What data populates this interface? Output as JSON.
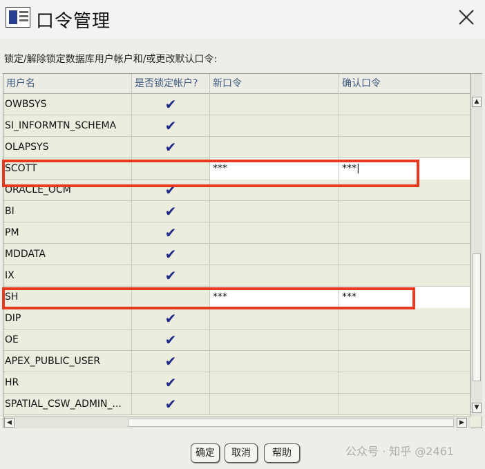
{
  "window": {
    "title": "口令管理",
    "close_glyph": "✕"
  },
  "instruction": "锁定/解除锁定数据库用户帐户和/或更改默认口令:",
  "table": {
    "headers": [
      "用户名",
      "是否锁定帐户?",
      "新口令",
      "确认口令"
    ],
    "rows": [
      {
        "user": "OWBSYS",
        "locked": "✔",
        "new_pw": "",
        "confirm_pw": ""
      },
      {
        "user": "SI_INFORMTN_SCHEMA",
        "locked": "✔",
        "new_pw": "",
        "confirm_pw": ""
      },
      {
        "user": "OLAPSYS",
        "locked": "✔",
        "new_pw": "",
        "confirm_pw": ""
      },
      {
        "user": "SCOTT",
        "locked": "",
        "new_pw": "***",
        "confirm_pw": "***|"
      },
      {
        "user": "ORACLE_OCM",
        "locked": "✔",
        "new_pw": "",
        "confirm_pw": ""
      },
      {
        "user": "BI",
        "locked": "✔",
        "new_pw": "",
        "confirm_pw": ""
      },
      {
        "user": "PM",
        "locked": "✔",
        "new_pw": "",
        "confirm_pw": ""
      },
      {
        "user": "MDDATA",
        "locked": "✔",
        "new_pw": "",
        "confirm_pw": ""
      },
      {
        "user": "IX",
        "locked": "✔",
        "new_pw": "",
        "confirm_pw": ""
      },
      {
        "user": "SH",
        "locked": "",
        "new_pw": "***",
        "confirm_pw": "***"
      },
      {
        "user": "DIP",
        "locked": "✔",
        "new_pw": "",
        "confirm_pw": ""
      },
      {
        "user": "OE",
        "locked": "✔",
        "new_pw": "",
        "confirm_pw": ""
      },
      {
        "user": "APEX_PUBLIC_USER",
        "locked": "✔",
        "new_pw": "",
        "confirm_pw": ""
      },
      {
        "user": "HR",
        "locked": "✔",
        "new_pw": "",
        "confirm_pw": ""
      },
      {
        "user": "SPATIAL_CSW_ADMIN_...",
        "locked": "✔",
        "new_pw": "",
        "confirm_pw": ""
      }
    ]
  },
  "scroll": {
    "up_glyph": "▲",
    "down_glyph": "▼",
    "left_glyph": "◀",
    "right_glyph": "▶"
  },
  "buttons": {
    "ok": "确定",
    "cancel": "取消",
    "help": "帮助"
  },
  "watermark": "公众号 · 知乎 @2461",
  "colors": {
    "highlight": "#e8381f",
    "check": "#1e2a8a",
    "header_text": "#3d5a80"
  }
}
